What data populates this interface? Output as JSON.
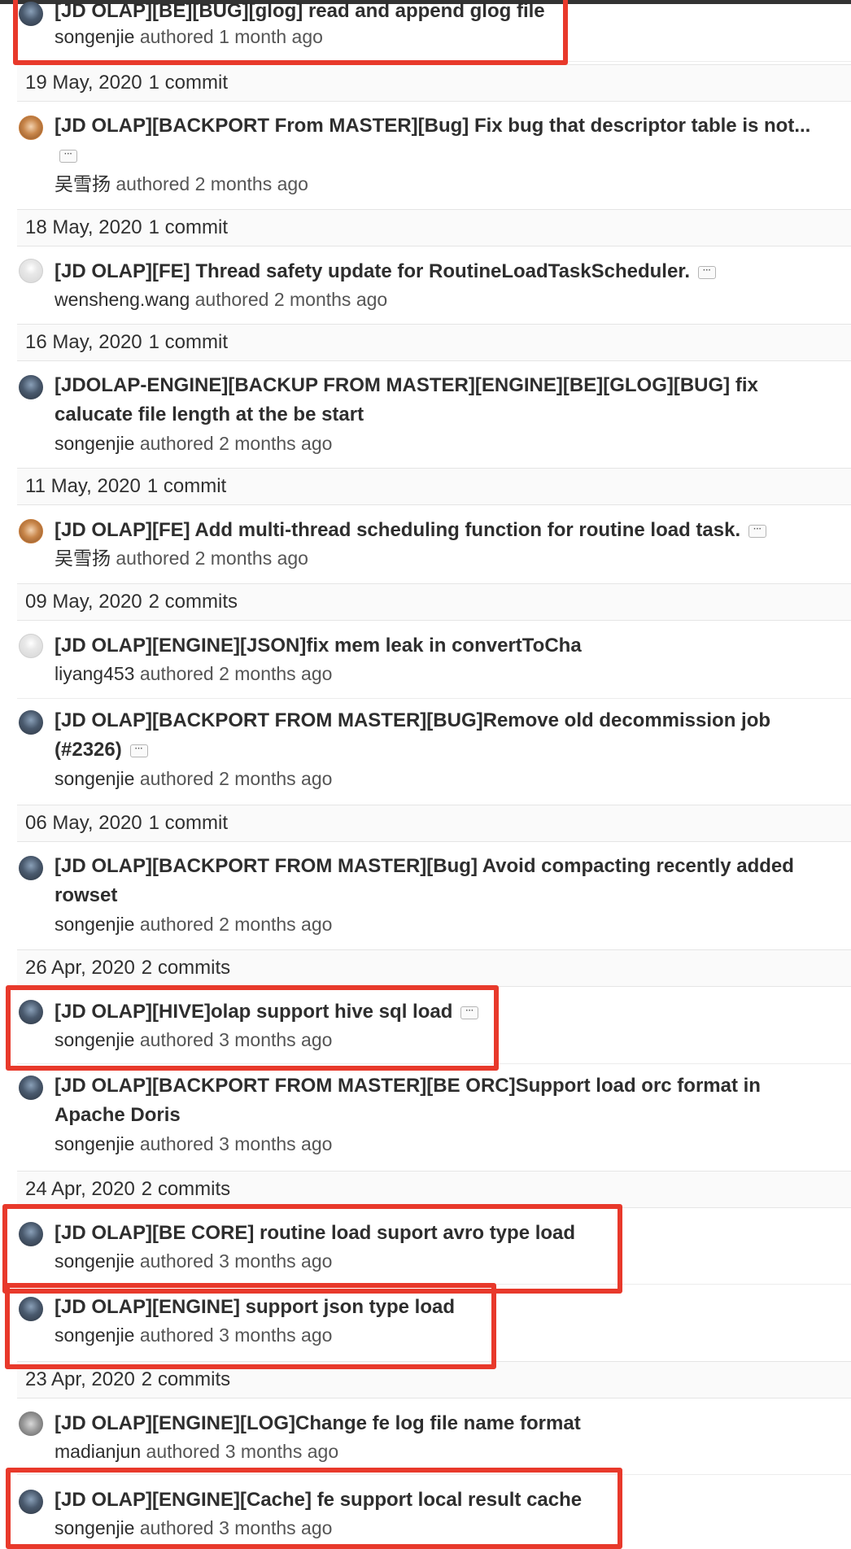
{
  "entries": [
    {
      "type": "commit",
      "title": "[JD OLAP][BE][BUG][glog] read and append glog file",
      "author": "songenjie",
      "verb": "authored",
      "time": "1 month ago",
      "avatar": "dark"
    },
    {
      "type": "day",
      "date": "19 May, 2020",
      "count": "1 commit"
    },
    {
      "type": "commit",
      "title": "[JD OLAP][BACKPORT From MASTER][Bug] Fix bug that descriptor table is not...",
      "author": "吴雪扬",
      "verb": "authored",
      "time": "2 months ago",
      "avatar": "orange",
      "ellipsis": true
    },
    {
      "type": "day",
      "date": "18 May, 2020",
      "count": "1 commit"
    },
    {
      "type": "commit",
      "title": "[JD OLAP][FE] Thread safety update for RoutineLoadTaskScheduler.",
      "author": "wensheng.wang",
      "verb": "authored",
      "time": "2 months ago",
      "avatar": "gray",
      "ellipsis": true
    },
    {
      "type": "day",
      "date": "16 May, 2020",
      "count": "1 commit"
    },
    {
      "type": "commit",
      "title": "[JDOLAP-ENGINE][BACKUP FROM MASTER][ENGINE][BE][GLOG][BUG] fix calucate file length at the be start",
      "author": "songenjie",
      "verb": "authored",
      "time": "2 months ago",
      "avatar": "dark"
    },
    {
      "type": "day",
      "date": "11 May, 2020",
      "count": "1 commit"
    },
    {
      "type": "commit",
      "title": "[JD OLAP][FE] Add multi-thread scheduling function for routine load task.",
      "author": "吴雪扬",
      "verb": "authored",
      "time": "2 months ago",
      "avatar": "orange",
      "ellipsis": true
    },
    {
      "type": "day",
      "date": "09 May, 2020",
      "count": "2 commits"
    },
    {
      "type": "commit",
      "title": "[JD OLAP][ENGINE][JSON]fix mem leak in convertToCha",
      "author": "liyang453",
      "verb": "authored",
      "time": "2 months ago",
      "avatar": "gray"
    },
    {
      "type": "commit",
      "title": "[JD OLAP][BACKPORT FROM MASTER][BUG]Remove old decommission job (#2326)",
      "author": "songenjie",
      "verb": "authored",
      "time": "2 months ago",
      "avatar": "dark",
      "ellipsis": true
    },
    {
      "type": "day",
      "date": "06 May, 2020",
      "count": "1 commit"
    },
    {
      "type": "commit",
      "title": "[JD OLAP][BACKPORT FROM MASTER][Bug] Avoid compacting recently added rowset",
      "author": "songenjie",
      "verb": "authored",
      "time": "2 months ago",
      "avatar": "dark"
    },
    {
      "type": "day",
      "date": "26 Apr, 2020",
      "count": "2 commits"
    },
    {
      "type": "commit",
      "title": "[JD OLAP][HIVE]olap support hive sql load",
      "author": "songenjie",
      "verb": "authored",
      "time": "3 months ago",
      "avatar": "dark",
      "ellipsis": true
    },
    {
      "type": "commit",
      "title": "[JD OLAP][BACKPORT FROM MASTER][BE ORC]Support load orc format in Apache Doris",
      "author": "songenjie",
      "verb": "authored",
      "time": "3 months ago",
      "avatar": "dark"
    },
    {
      "type": "day",
      "date": "24 Apr, 2020",
      "count": "2 commits"
    },
    {
      "type": "commit",
      "title": "[JD OLAP][BE CORE] routine load suport avro type load",
      "author": "songenjie",
      "verb": "authored",
      "time": "3 months ago",
      "avatar": "dark"
    },
    {
      "type": "commit",
      "title": "[JD OLAP][ENGINE] support json type load",
      "author": "songenjie",
      "verb": "authored",
      "time": "3 months ago",
      "avatar": "dark"
    },
    {
      "type": "day",
      "date": "23 Apr, 2020",
      "count": "2 commits"
    },
    {
      "type": "commit",
      "title": "[JD OLAP][ENGINE][LOG]Change fe log file name format",
      "author": "madianjun",
      "verb": "authored",
      "time": "3 months ago",
      "avatar": "koala"
    },
    {
      "type": "commit",
      "title": "[JD OLAP][ENGINE][Cache] fe support local result cache",
      "author": "songenjie",
      "verb": "authored",
      "time": "3 months ago",
      "avatar": "dark"
    }
  ],
  "colors": {
    "highlight": "#e8392b",
    "day_bg": "#fafafa",
    "text": "#2e2e2e"
  }
}
